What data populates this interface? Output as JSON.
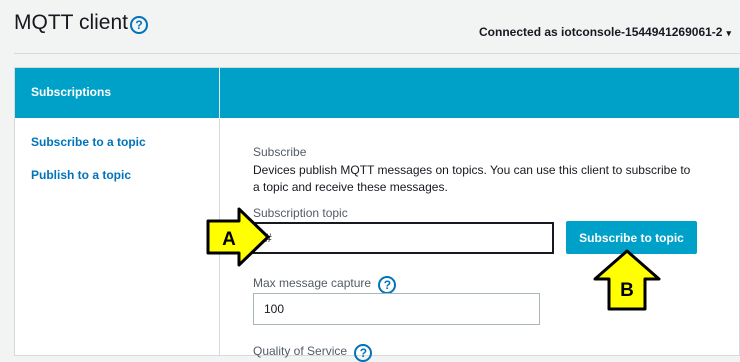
{
  "header": {
    "title": "MQTT client",
    "help_icon": "question-circle-icon",
    "connection_status": "Connected as iotconsole-1544941269061-2",
    "connection_caret": "▾"
  },
  "sidebar": {
    "section_title": "Subscriptions",
    "items": [
      {
        "label": "Subscribe to a topic"
      },
      {
        "label": "Publish to a topic"
      }
    ]
  },
  "main": {
    "section_title": "Subscribe",
    "description": "Devices publish MQTT messages on topics. You can use this client to subscribe to a topic and receive these messages.",
    "topic_label": "Subscription topic",
    "topic_value": "#",
    "subscribe_button": "Subscribe to topic",
    "max_capture_label": "Max message capture",
    "max_capture_value": "100",
    "qos_label": "Quality of Service"
  },
  "annotations": {
    "a": "A",
    "b": "B",
    "color": "#ffff00"
  },
  "colors": {
    "accent": "#00a1c9",
    "link": "#0073bb"
  }
}
